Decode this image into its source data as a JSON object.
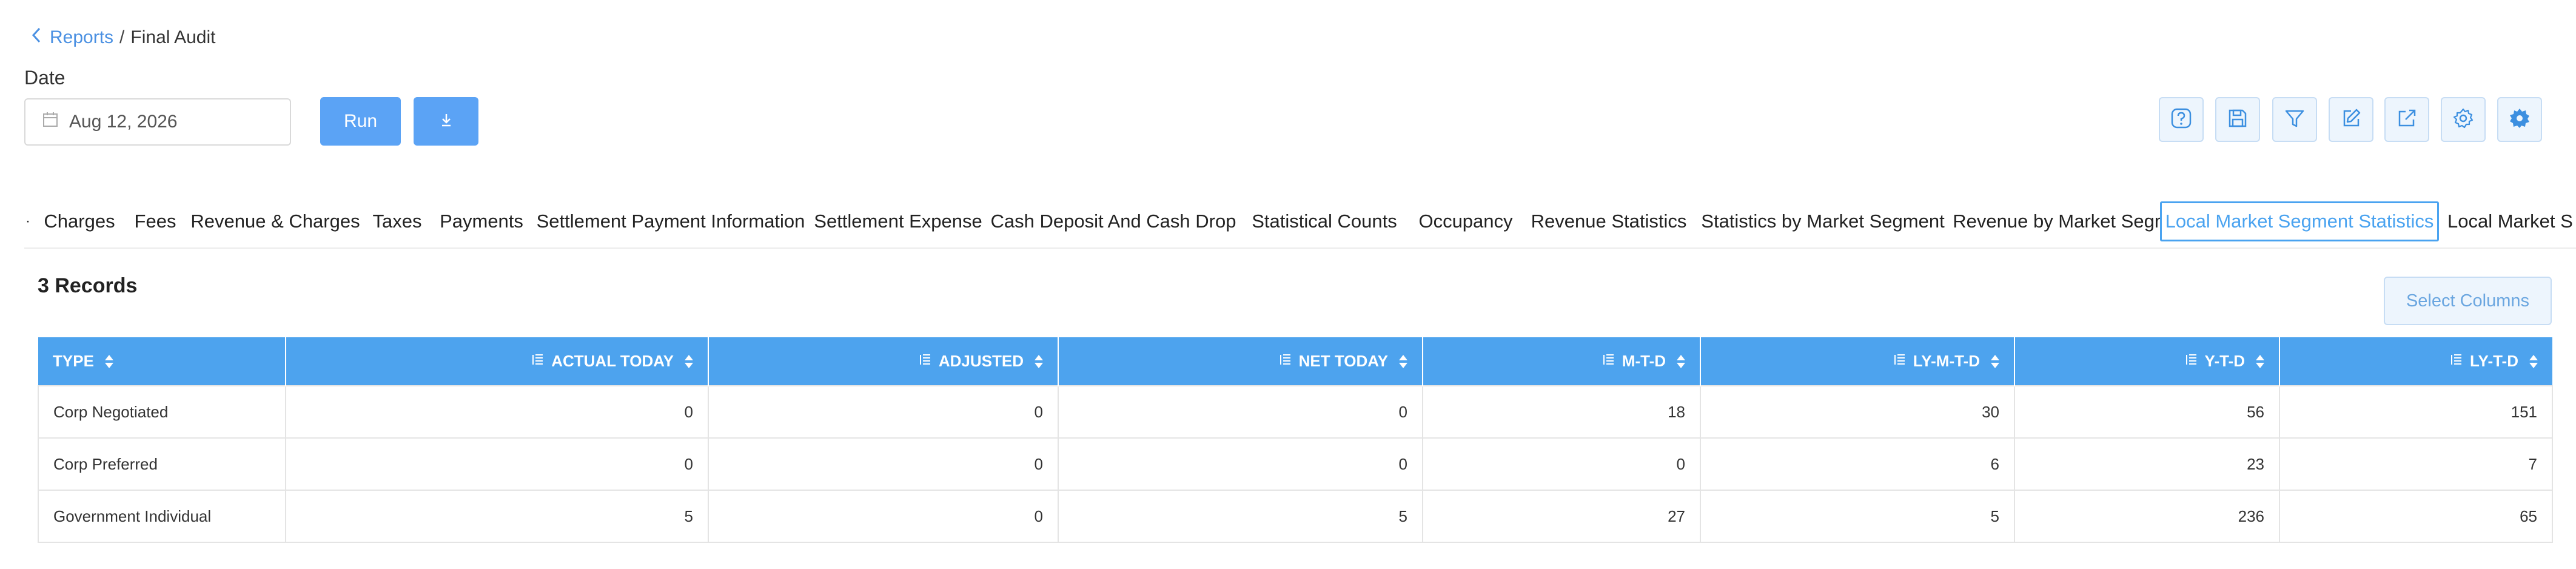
{
  "breadcrumb": {
    "parent": "Reports",
    "separator": "/",
    "current": "Final Audit"
  },
  "date": {
    "label": "Date",
    "value": "Aug 12, 2026"
  },
  "actions": {
    "run_label": "Run"
  },
  "toolbar": {
    "icons": [
      "help-icon",
      "save-icon",
      "filter-icon",
      "edit-icon",
      "export-icon",
      "settings-icon",
      "config-gear-icon"
    ]
  },
  "tabs": [
    {
      "label": "Charges"
    },
    {
      "label": "Fees"
    },
    {
      "label": "Revenue & Charges"
    },
    {
      "label": "Taxes"
    },
    {
      "label": "Payments"
    },
    {
      "label": "Settlement Payment Information"
    },
    {
      "label": "Settlement Expense"
    },
    {
      "label": "Cash Deposit And Cash Drop"
    },
    {
      "label": "Statistical Counts"
    },
    {
      "label": "Occupancy"
    },
    {
      "label": "Revenue Statistics"
    },
    {
      "label": "Statistics by Market Segment"
    },
    {
      "label": "Revenue by Market Segment"
    },
    {
      "label": "Local Market Segment Statistics",
      "active": true
    },
    {
      "label": "Local Market S"
    }
  ],
  "records_label": "3 Records",
  "select_columns_label": "Select Columns",
  "table": {
    "columns": [
      "TYPE",
      "ACTUAL TODAY",
      "ADJUSTED",
      "NET TODAY",
      "M-T-D",
      "LY-M-T-D",
      "Y-T-D",
      "LY-T-D"
    ],
    "rows": [
      [
        "Corp Negotiated",
        "0",
        "0",
        "0",
        "18",
        "30",
        "56",
        "151"
      ],
      [
        "Corp Preferred",
        "0",
        "0",
        "0",
        "0",
        "6",
        "23",
        "7"
      ],
      [
        "Government Individual",
        "5",
        "0",
        "5",
        "27",
        "5",
        "236",
        "65"
      ]
    ]
  },
  "colors": {
    "accent": "#4da3ee",
    "button": "#5ba3f5",
    "link": "#4a90e2"
  }
}
